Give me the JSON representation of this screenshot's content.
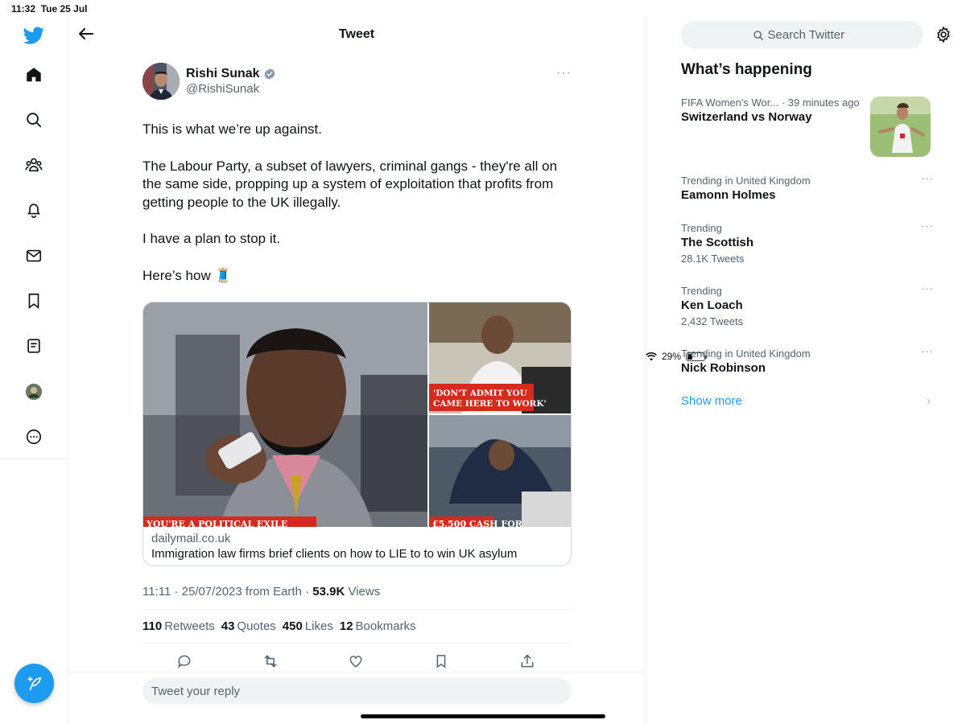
{
  "status_bar": {
    "time": "11:32",
    "date": "Tue 25 Jul",
    "battery": "29%",
    "battery_fraction": 0.29
  },
  "left_nav": {
    "items": [
      "twitter-logo",
      "home",
      "search",
      "communities",
      "notifications",
      "messages",
      "bookmarks",
      "lists",
      "profile",
      "more"
    ],
    "compose_icon": "feather-plus-icon"
  },
  "header": {
    "title": "Tweet"
  },
  "tweet": {
    "author_name": "Rishi Sunak",
    "author_handle": "@RishiSunak",
    "paragraphs": [
      "This is what we’re up against.",
      "The Labour Party, a subset of lawyers, criminal gangs - they're all on the same side, propping up a system of exploitation that profits from getting people to the UK illegally.",
      "I have a plan to stop it.",
      "Here’s how 🧵"
    ],
    "card": {
      "domain": "dailymail.co.uk",
      "title": "Immigration law firms brief clients on how to LIE to to win UK asylum",
      "caption_main": "YOU'RE A POLITICAL EXILE",
      "caption_top_right": "'DON'T ADMIT YOU CAME HERE TO WORK'",
      "caption_bottom_right": "£5,500 CASH FOR"
    },
    "meta": {
      "time": "11:11",
      "date": "25/07/2023",
      "source": "from Earth",
      "views_count": "53.9K",
      "views_label": "Views"
    },
    "stats": [
      {
        "num": "110",
        "label": "Retweets"
      },
      {
        "num": "43",
        "label": "Quotes"
      },
      {
        "num": "450",
        "label": "Likes"
      },
      {
        "num": "12",
        "label": "Bookmarks"
      }
    ],
    "actions": [
      "reply-icon",
      "retweet-icon",
      "like-icon",
      "bookmark-icon",
      "share-icon"
    ]
  },
  "reply": {
    "placeholder": "Tweet your reply"
  },
  "sidebar": {
    "search_placeholder": "Search Twitter",
    "section_title": "What’s happening",
    "trends": [
      {
        "context": "FIFA Women's Wor... · 39 minutes ago",
        "title": "Switzerland vs Norway",
        "count": ""
      },
      {
        "context": "Trending in United Kingdom",
        "title": "Eamonn Holmes",
        "count": ""
      },
      {
        "context": "Trending",
        "title": "The Scottish",
        "count": "28.1K Tweets"
      },
      {
        "context": "Trending",
        "title": "Ken Loach",
        "count": "2,432 Tweets"
      },
      {
        "context": "Trending in United Kingdom",
        "title": "Nick Robinson",
        "count": ""
      }
    ],
    "show_more": "Show more"
  },
  "colors": {
    "accent": "#1d9bf0",
    "text": "#0f1419",
    "muted": "#536471",
    "verified": "#829aab"
  }
}
